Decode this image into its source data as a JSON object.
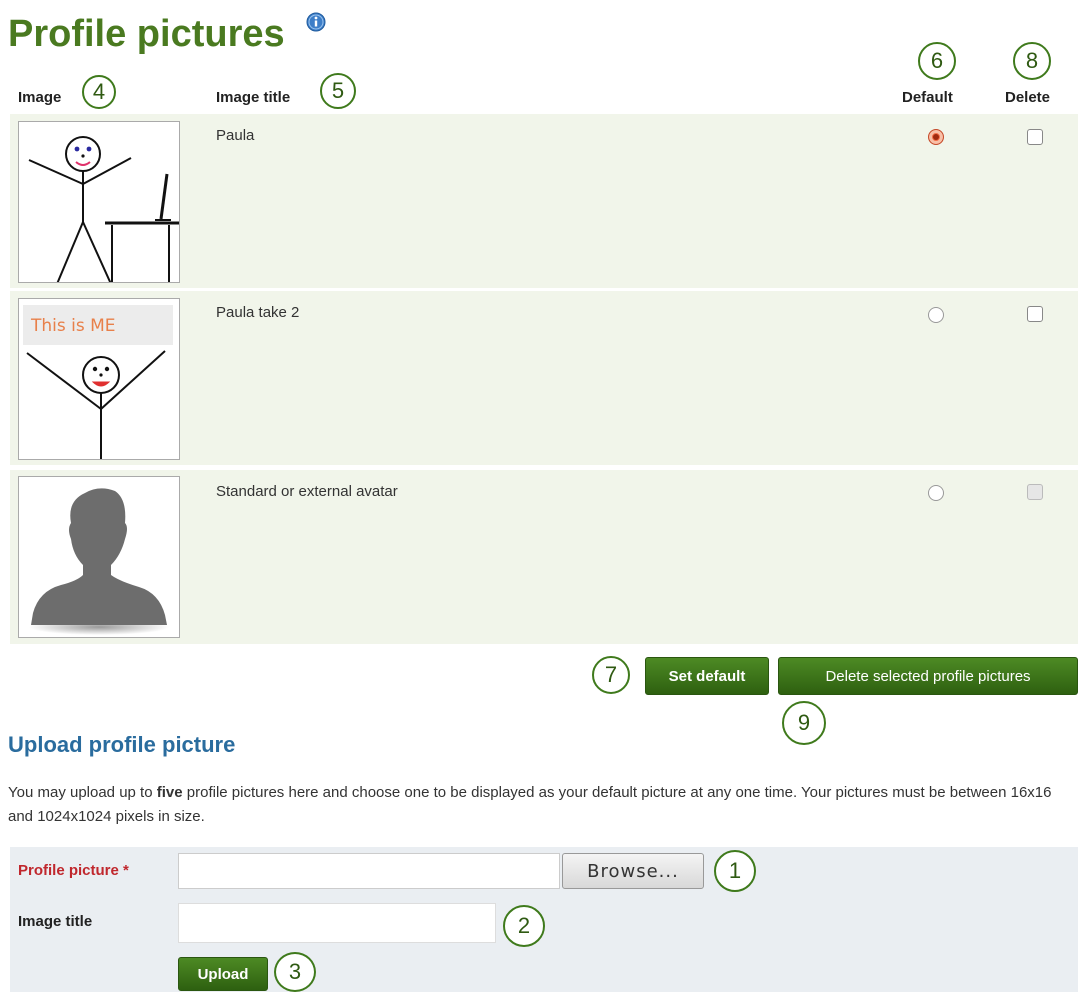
{
  "page": {
    "title": "Profile pictures",
    "info_icon": "info-icon"
  },
  "table": {
    "headers": {
      "image": "Image",
      "image_title": "Image title",
      "default": "Default",
      "delete": "Delete"
    },
    "rows": [
      {
        "title": "Paula",
        "image": "stick-figure-at-desk",
        "default": true,
        "delete_checked": false,
        "delete_disabled": false
      },
      {
        "title": "Paula take 2",
        "image": "stick-figure-this-is-me",
        "default": false,
        "delete_checked": false,
        "delete_disabled": false
      },
      {
        "title": "Standard or external avatar",
        "image": "default-avatar-silhouette",
        "default": false,
        "delete_checked": false,
        "delete_disabled": true
      }
    ],
    "drawing_text": "This is ME"
  },
  "actions": {
    "set_default": "Set default",
    "delete_selected": "Delete selected profile pictures"
  },
  "upload": {
    "heading": "Upload profile picture",
    "desc_part1": "You may upload up to ",
    "desc_bold": "five",
    "desc_part2": " profile pictures here and choose one to be displayed as your default picture at any one time. Your pictures must be between 16x16 and 1024x1024 pixels in size.",
    "file_label": "Profile picture",
    "required_mark": "*",
    "file_value": "",
    "browse_label": "Browse...",
    "title_label": "Image title",
    "title_value": "",
    "upload_button": "Upload"
  },
  "callouts": [
    "1",
    "2",
    "3",
    "4",
    "5",
    "6",
    "7",
    "8",
    "9"
  ],
  "colors": {
    "heading_green": "#4a7a20",
    "section_blue": "#2a6c9e",
    "row_bg": "#f1f5ea",
    "form_bg": "#eaeef2",
    "button_green": "#3e7a1c",
    "required_red": "#c0272d",
    "radio_selected": "#f36c46"
  }
}
